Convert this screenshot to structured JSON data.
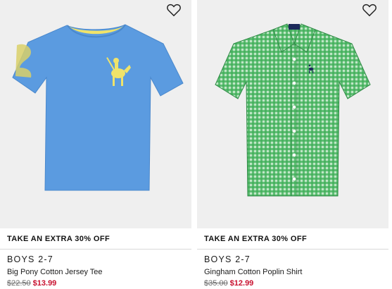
{
  "products": [
    {
      "promo": "TAKE AN EXTRA 30% OFF",
      "category": "BOYS 2-7",
      "name": "Big Pony Cotton Jersey Tee",
      "original_price": "$22.50",
      "sale_price": "$13.99",
      "image_icon": "blue-tshirt-image",
      "colors": {
        "garment": "#5b9be0",
        "pony": "#f0e36a"
      }
    },
    {
      "promo": "TAKE AN EXTRA 30% OFF",
      "category": "BOYS 2-7",
      "name": "Gingham Cotton Poplin Shirt",
      "original_price": "$35.00",
      "sale_price": "$12.99",
      "image_icon": "green-gingham-shirt-image",
      "colors": {
        "garment": "#3fae58",
        "pony": "#1c2a5a"
      }
    }
  ],
  "favorite_icon": "heart-outline-icon",
  "colors": {
    "sale": "#c8102e",
    "background": "#efefef"
  }
}
